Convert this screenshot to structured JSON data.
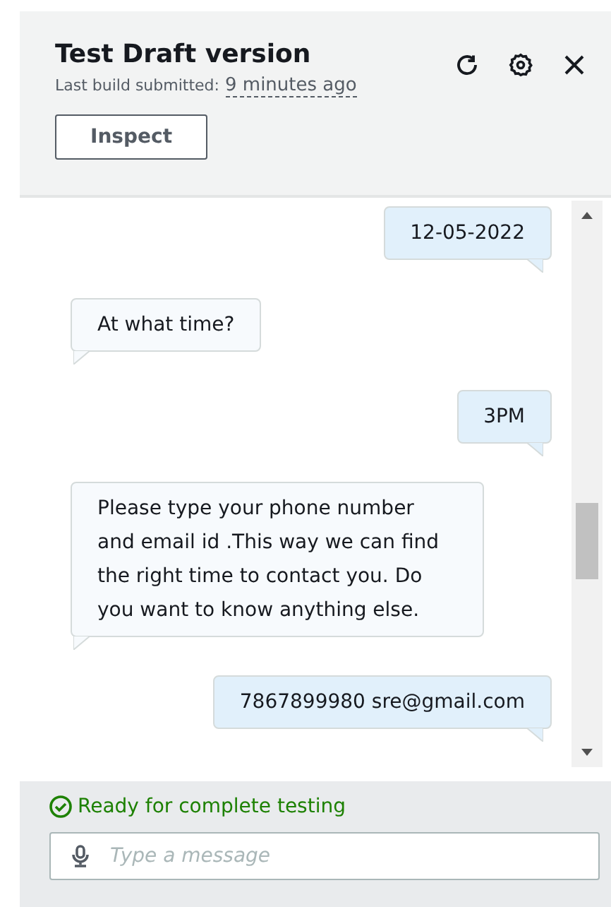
{
  "header": {
    "title": "Test Draft version",
    "subtitle_label": "Last build submitted:",
    "subtitle_time": "9 minutes ago",
    "inspect_button": "Inspect"
  },
  "messages": [
    {
      "kind": "user",
      "text": "12-05-2022"
    },
    {
      "kind": "bot",
      "text": "At what time?"
    },
    {
      "kind": "user",
      "text": "3PM"
    },
    {
      "kind": "bot",
      "text": "Please type your phone number and email id .This way we can find the right time to contact you. Do you want to know anything else."
    },
    {
      "kind": "user",
      "text": "7867899980 sre@gmail.com"
    }
  ],
  "footer": {
    "status": "Ready for complete testing",
    "input": {
      "placeholder": "Type a message"
    }
  }
}
